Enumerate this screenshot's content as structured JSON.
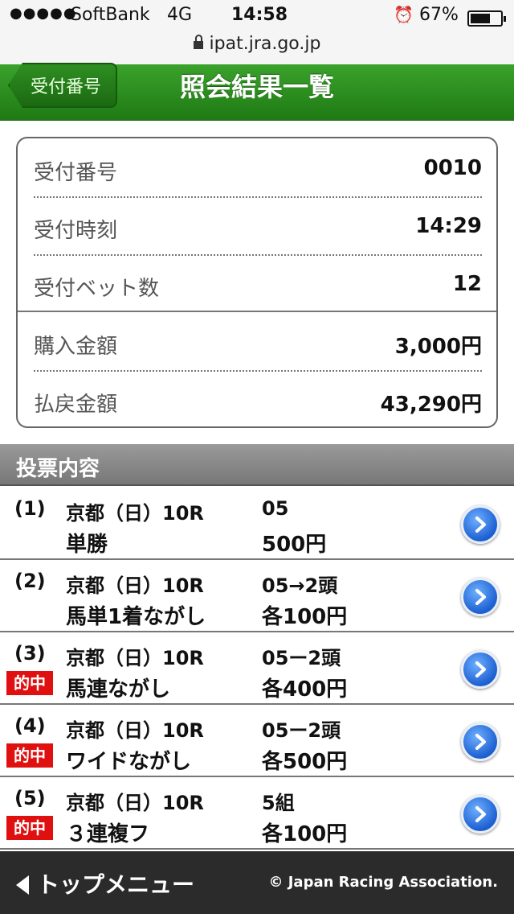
{
  "status_bar": {
    "signal": "●●●●●",
    "carrier": "SoftBank",
    "network": "4G",
    "time": "14:58",
    "battery_percent": "67%",
    "battery_level": 0.67,
    "url": "ipat.jra.go.jp"
  },
  "header": {
    "back_label": "受付番号",
    "title": "照会結果一覧",
    "color": "#2a8d1e"
  },
  "summary": [
    {
      "label": "受付番号",
      "value": "0010"
    },
    {
      "label": "受付時刻",
      "value": "14:29"
    },
    {
      "label": "受付ベット数",
      "value": "12"
    },
    {
      "label": "購入金額",
      "value": "3,000円"
    },
    {
      "label": "払戻金額",
      "value": "43,290円"
    }
  ],
  "section_title": "投票内容",
  "bets": [
    {
      "no": "(1)",
      "race": "京都（日）10R",
      "type": "単勝",
      "selection": "05",
      "amount": "500円",
      "hit": ""
    },
    {
      "no": "(2)",
      "race": "京都（日）10R",
      "type": "馬単1着ながし",
      "selection": "05→2頭",
      "amount": "各100円",
      "hit": ""
    },
    {
      "no": "(3)",
      "race": "京都（日）10R",
      "type": "馬連ながし",
      "selection": "05ー2頭",
      "amount": "各400円",
      "hit": "的中"
    },
    {
      "no": "(4)",
      "race": "京都（日）10R",
      "type": "ワイドながし",
      "selection": "05ー2頭",
      "amount": "各500円",
      "hit": "的中"
    },
    {
      "no": "(5)",
      "race": "京都（日）10R",
      "type": "３連複フ",
      "selection": "5組",
      "amount": "各100円",
      "hit": "的中"
    }
  ],
  "footer": {
    "top_menu": "トップメニュー",
    "copyright": "© Japan Racing Association."
  }
}
